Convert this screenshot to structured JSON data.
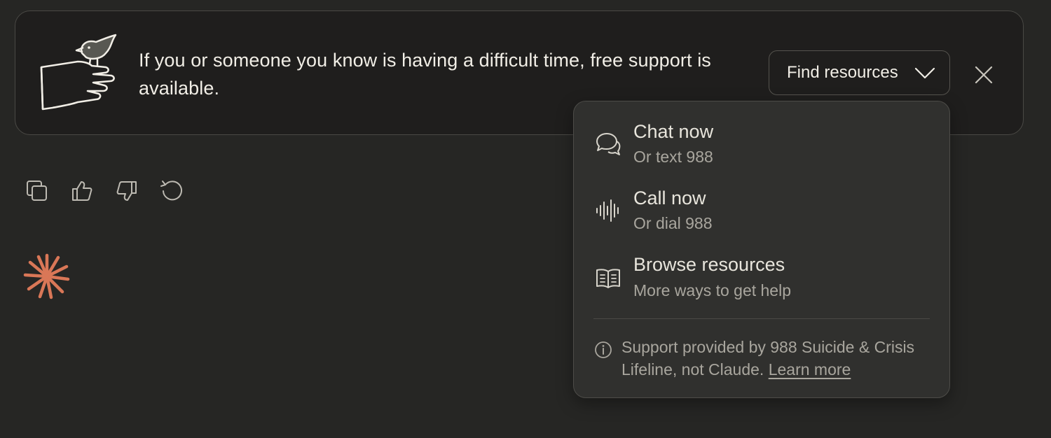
{
  "banner": {
    "message": "If you or someone you know is having a difficult time, free support is available.",
    "find_resources_label": "Find resources",
    "illustration_icon": "hand-holding-bird-illustration",
    "close_icon": "close-icon"
  },
  "message_actions": [
    {
      "icon": "copy-icon"
    },
    {
      "icon": "thumbs-up-icon"
    },
    {
      "icon": "thumbs-down-icon"
    },
    {
      "icon": "retry-icon"
    }
  ],
  "assistant_logo": {
    "icon": "claude-spark-icon",
    "color": "#d97757"
  },
  "resources_menu": {
    "items": [
      {
        "title": "Chat now",
        "subtitle": "Or text 988",
        "icon": "chat-bubbles-icon"
      },
      {
        "title": "Call now",
        "subtitle": "Or dial 988",
        "icon": "sound-wave-icon"
      },
      {
        "title": "Browse resources",
        "subtitle": "More ways to get help",
        "icon": "open-book-icon"
      }
    ],
    "footnote": "Support provided by 988 Suicide & Crisis Lifeline, not Claude.",
    "learn_more_label": "Learn more",
    "info_icon": "info-icon"
  },
  "colors": {
    "background": "#262624",
    "banner_background": "#1f1e1d",
    "menu_background": "#30302e",
    "accent": "#d97757"
  }
}
